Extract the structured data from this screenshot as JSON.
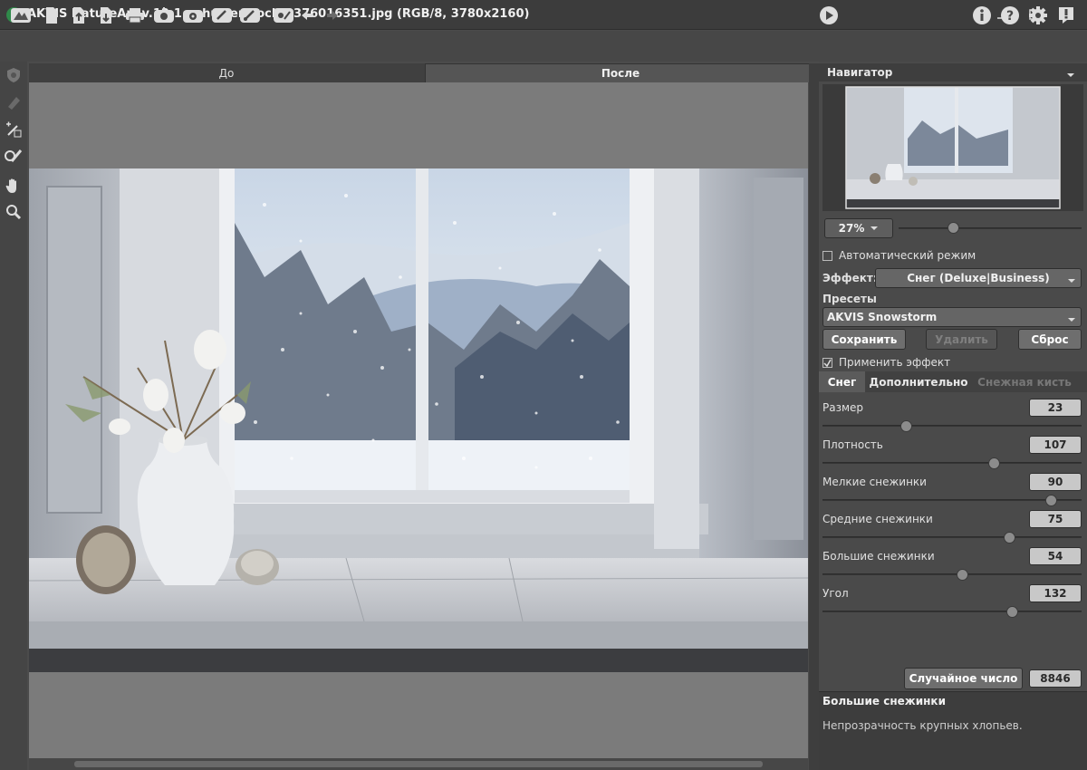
{
  "window": {
    "title": "AKVIS NatureArt v.12.1 - shutterstock_2376016351.jpg (RGB/8, 3780x2160)"
  },
  "tabs": {
    "before": "До",
    "after": "После"
  },
  "navigator": {
    "title": "Навигатор",
    "zoom": "27%"
  },
  "settings": {
    "auto_mode_label": "Автоматический режим",
    "auto_mode_checked": false,
    "effect_label": "Эффект:",
    "effect_value": "Снег (Deluxe|Business)",
    "presets_label": "Пресеты",
    "preset_value": "AKVIS Snowstorm",
    "save_label": "Сохранить",
    "delete_label": "Удалить",
    "reset_label": "Сброс",
    "apply_label": "Применить эффект",
    "apply_checked": true
  },
  "subtabs": {
    "snow": "Снег",
    "advanced": "Дополнительно",
    "snow_brush": "Снежная кисть"
  },
  "params": [
    {
      "label": "Размер",
      "value": "23",
      "pos": 0.32
    },
    {
      "label": "Плотность",
      "value": "107",
      "pos": 0.66
    },
    {
      "label": "Мелкие снежинки",
      "value": "90",
      "pos": 0.88
    },
    {
      "label": "Средние снежинки",
      "value": "75",
      "pos": 0.72
    },
    {
      "label": "Большие снежинки",
      "value": "54",
      "pos": 0.54
    },
    {
      "label": "Угол",
      "value": "132",
      "pos": 0.73
    }
  ],
  "random": {
    "label": "Случайное число",
    "value": "8846"
  },
  "help": {
    "title": "Большие снежинки",
    "text": "Непрозрачность крупных хлопьев."
  }
}
